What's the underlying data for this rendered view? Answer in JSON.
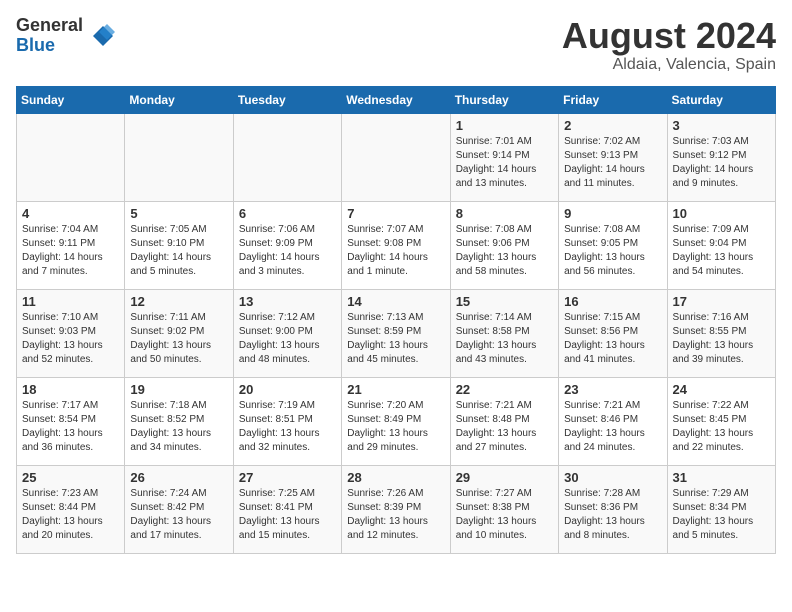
{
  "logo": {
    "general": "General",
    "blue": "Blue"
  },
  "header": {
    "month": "August 2024",
    "location": "Aldaia, Valencia, Spain"
  },
  "weekdays": [
    "Sunday",
    "Monday",
    "Tuesday",
    "Wednesday",
    "Thursday",
    "Friday",
    "Saturday"
  ],
  "weeks": [
    [
      {
        "day": "",
        "info": ""
      },
      {
        "day": "",
        "info": ""
      },
      {
        "day": "",
        "info": ""
      },
      {
        "day": "",
        "info": ""
      },
      {
        "day": "1",
        "info": "Sunrise: 7:01 AM\nSunset: 9:14 PM\nDaylight: 14 hours\nand 13 minutes."
      },
      {
        "day": "2",
        "info": "Sunrise: 7:02 AM\nSunset: 9:13 PM\nDaylight: 14 hours\nand 11 minutes."
      },
      {
        "day": "3",
        "info": "Sunrise: 7:03 AM\nSunset: 9:12 PM\nDaylight: 14 hours\nand 9 minutes."
      }
    ],
    [
      {
        "day": "4",
        "info": "Sunrise: 7:04 AM\nSunset: 9:11 PM\nDaylight: 14 hours\nand 7 minutes."
      },
      {
        "day": "5",
        "info": "Sunrise: 7:05 AM\nSunset: 9:10 PM\nDaylight: 14 hours\nand 5 minutes."
      },
      {
        "day": "6",
        "info": "Sunrise: 7:06 AM\nSunset: 9:09 PM\nDaylight: 14 hours\nand 3 minutes."
      },
      {
        "day": "7",
        "info": "Sunrise: 7:07 AM\nSunset: 9:08 PM\nDaylight: 14 hours\nand 1 minute."
      },
      {
        "day": "8",
        "info": "Sunrise: 7:08 AM\nSunset: 9:06 PM\nDaylight: 13 hours\nand 58 minutes."
      },
      {
        "day": "9",
        "info": "Sunrise: 7:08 AM\nSunset: 9:05 PM\nDaylight: 13 hours\nand 56 minutes."
      },
      {
        "day": "10",
        "info": "Sunrise: 7:09 AM\nSunset: 9:04 PM\nDaylight: 13 hours\nand 54 minutes."
      }
    ],
    [
      {
        "day": "11",
        "info": "Sunrise: 7:10 AM\nSunset: 9:03 PM\nDaylight: 13 hours\nand 52 minutes."
      },
      {
        "day": "12",
        "info": "Sunrise: 7:11 AM\nSunset: 9:02 PM\nDaylight: 13 hours\nand 50 minutes."
      },
      {
        "day": "13",
        "info": "Sunrise: 7:12 AM\nSunset: 9:00 PM\nDaylight: 13 hours\nand 48 minutes."
      },
      {
        "day": "14",
        "info": "Sunrise: 7:13 AM\nSunset: 8:59 PM\nDaylight: 13 hours\nand 45 minutes."
      },
      {
        "day": "15",
        "info": "Sunrise: 7:14 AM\nSunset: 8:58 PM\nDaylight: 13 hours\nand 43 minutes."
      },
      {
        "day": "16",
        "info": "Sunrise: 7:15 AM\nSunset: 8:56 PM\nDaylight: 13 hours\nand 41 minutes."
      },
      {
        "day": "17",
        "info": "Sunrise: 7:16 AM\nSunset: 8:55 PM\nDaylight: 13 hours\nand 39 minutes."
      }
    ],
    [
      {
        "day": "18",
        "info": "Sunrise: 7:17 AM\nSunset: 8:54 PM\nDaylight: 13 hours\nand 36 minutes."
      },
      {
        "day": "19",
        "info": "Sunrise: 7:18 AM\nSunset: 8:52 PM\nDaylight: 13 hours\nand 34 minutes."
      },
      {
        "day": "20",
        "info": "Sunrise: 7:19 AM\nSunset: 8:51 PM\nDaylight: 13 hours\nand 32 minutes."
      },
      {
        "day": "21",
        "info": "Sunrise: 7:20 AM\nSunset: 8:49 PM\nDaylight: 13 hours\nand 29 minutes."
      },
      {
        "day": "22",
        "info": "Sunrise: 7:21 AM\nSunset: 8:48 PM\nDaylight: 13 hours\nand 27 minutes."
      },
      {
        "day": "23",
        "info": "Sunrise: 7:21 AM\nSunset: 8:46 PM\nDaylight: 13 hours\nand 24 minutes."
      },
      {
        "day": "24",
        "info": "Sunrise: 7:22 AM\nSunset: 8:45 PM\nDaylight: 13 hours\nand 22 minutes."
      }
    ],
    [
      {
        "day": "25",
        "info": "Sunrise: 7:23 AM\nSunset: 8:44 PM\nDaylight: 13 hours\nand 20 minutes."
      },
      {
        "day": "26",
        "info": "Sunrise: 7:24 AM\nSunset: 8:42 PM\nDaylight: 13 hours\nand 17 minutes."
      },
      {
        "day": "27",
        "info": "Sunrise: 7:25 AM\nSunset: 8:41 PM\nDaylight: 13 hours\nand 15 minutes."
      },
      {
        "day": "28",
        "info": "Sunrise: 7:26 AM\nSunset: 8:39 PM\nDaylight: 13 hours\nand 12 minutes."
      },
      {
        "day": "29",
        "info": "Sunrise: 7:27 AM\nSunset: 8:38 PM\nDaylight: 13 hours\nand 10 minutes."
      },
      {
        "day": "30",
        "info": "Sunrise: 7:28 AM\nSunset: 8:36 PM\nDaylight: 13 hours\nand 8 minutes."
      },
      {
        "day": "31",
        "info": "Sunrise: 7:29 AM\nSunset: 8:34 PM\nDaylight: 13 hours\nand 5 minutes."
      }
    ]
  ]
}
